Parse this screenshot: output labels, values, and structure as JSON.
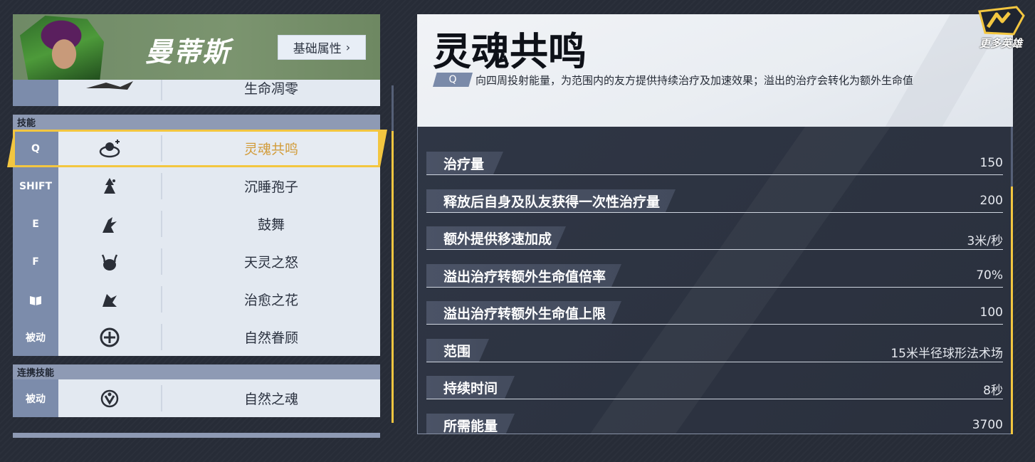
{
  "hero": {
    "name": "曼蒂斯",
    "base_attr_label": "基础属性"
  },
  "skills": {
    "partial_row": {
      "key": "",
      "name": "生命凋零"
    },
    "section_title": "技能",
    "items": [
      {
        "key": "Q",
        "name": "灵魂共鸣",
        "icon": "soul-resonance-icon",
        "selected": true
      },
      {
        "key": "SHIFT",
        "name": "沉睡孢子",
        "icon": "sleep-spore-icon"
      },
      {
        "key": "E",
        "name": "鼓舞",
        "icon": "inspire-icon"
      },
      {
        "key": "F",
        "name": "天灵之怒",
        "icon": "celestial-wrath-icon"
      },
      {
        "key": "",
        "name": "治愈之花",
        "icon": "healing-flower-icon"
      },
      {
        "key": "被动",
        "name": "自然眷顾",
        "icon": "nature-grace-icon"
      }
    ],
    "combo_section_title": "连携技能",
    "combo_items": [
      {
        "key": "被动",
        "name": "自然之魂",
        "icon": "nature-soul-icon"
      }
    ]
  },
  "detail": {
    "title": "灵魂共鸣",
    "key": "Q",
    "description": "向四周投射能量，为范围内的友方提供持续治疗及加速效果；溢出的治疗会转化为额外生命值",
    "stats": [
      {
        "label": "治疗量",
        "value": "150"
      },
      {
        "label": "释放后自身及队友获得一次性治疗量",
        "value": "200"
      },
      {
        "label": "额外提供移速加成",
        "value": "3米/秒"
      },
      {
        "label": "溢出治疗转额外生命值倍率",
        "value": "70%"
      },
      {
        "label": "溢出治疗转额外生命值上限",
        "value": "100"
      },
      {
        "label": "范围",
        "value": "15米半径球形法术场"
      },
      {
        "label": "持续时间",
        "value": "8秒"
      },
      {
        "label": "所需能量",
        "value": "3700"
      }
    ]
  },
  "logo": {
    "text": "更多英雄"
  },
  "colors": {
    "accent": "#f3c640",
    "selected_text": "#d29c3a",
    "key_bg": "#7c8cab"
  }
}
